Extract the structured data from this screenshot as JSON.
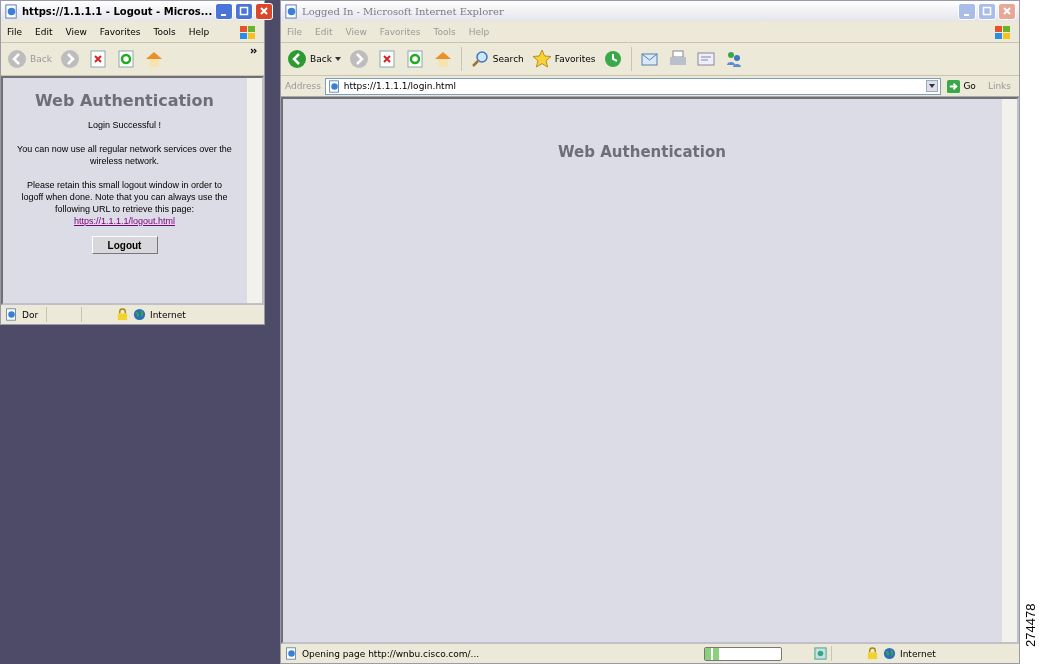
{
  "logout_window": {
    "title": "https://1.1.1.1 - Logout - Micros...",
    "active": true,
    "menu": [
      "File",
      "Edit",
      "View",
      "Favorites",
      "Tools",
      "Help"
    ],
    "back": "Back",
    "heading": "Web Authentication",
    "status": "Login Successful !",
    "message": "You can now use all regular network services over the wireless network.",
    "note": "Please retain this small logout window in order to logoff when done. Note that you can always use the following URL to retrieve this page:",
    "link": "https://1.1.1.1/logout.html",
    "button": "Logout",
    "status_bar": {
      "text": "Dor",
      "zone": "Internet"
    }
  },
  "browser_window": {
    "title": "Logged In - Microsoft Internet Explorer",
    "active": false,
    "menu": [
      "File",
      "Edit",
      "View",
      "Favorites",
      "Tools",
      "Help"
    ],
    "back": "Back",
    "search": "Search",
    "favorites": "Favorites",
    "address_label": "Address",
    "url": "https://1.1.1.1/login.html",
    "go": "Go",
    "links": "Links",
    "heading": "Web Authentication",
    "status_bar": {
      "text": "Opening page http://wnbu.cisco.com/...",
      "level": 0.2,
      "zone": "Internet"
    }
  },
  "figure_number": "274478"
}
